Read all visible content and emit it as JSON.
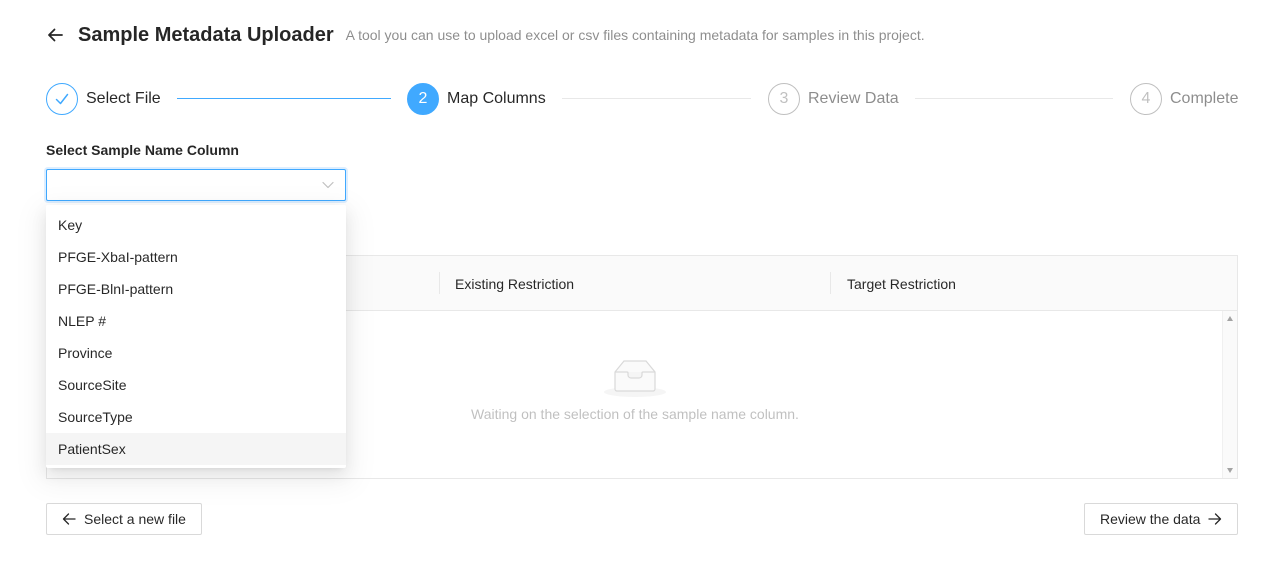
{
  "header": {
    "title": "Sample Metadata Uploader",
    "subtitle": "A tool you can use to upload excel or csv files containing metadata for samples in this project.",
    "back_icon": "arrow-left-icon"
  },
  "steps": [
    {
      "number": "1",
      "label": "Select File",
      "status": "finish"
    },
    {
      "number": "2",
      "label": "Map Columns",
      "status": "process"
    },
    {
      "number": "3",
      "label": "Review Data",
      "status": "wait"
    },
    {
      "number": "4",
      "label": "Complete",
      "status": "wait"
    }
  ],
  "sample_column": {
    "label": "Select Sample Name Column",
    "value": "",
    "options": [
      "Key",
      "PFGE-XbaI-pattern",
      "PFGE-BlnI-pattern",
      "NLEP #",
      "Province",
      "SourceSite",
      "SourceType",
      "PatientSex"
    ],
    "hovered_option": "PatientSex"
  },
  "table": {
    "columns": [
      "Existing Restriction",
      "Target Restriction"
    ],
    "empty_text": "Waiting on the selection of the sample name column."
  },
  "footer": {
    "back_label": "Select a new file",
    "next_label": "Review the data"
  },
  "colors": {
    "primary": "#40a9ff",
    "border": "#d9d9d9",
    "muted": "rgba(0,0,0,0.45)"
  }
}
